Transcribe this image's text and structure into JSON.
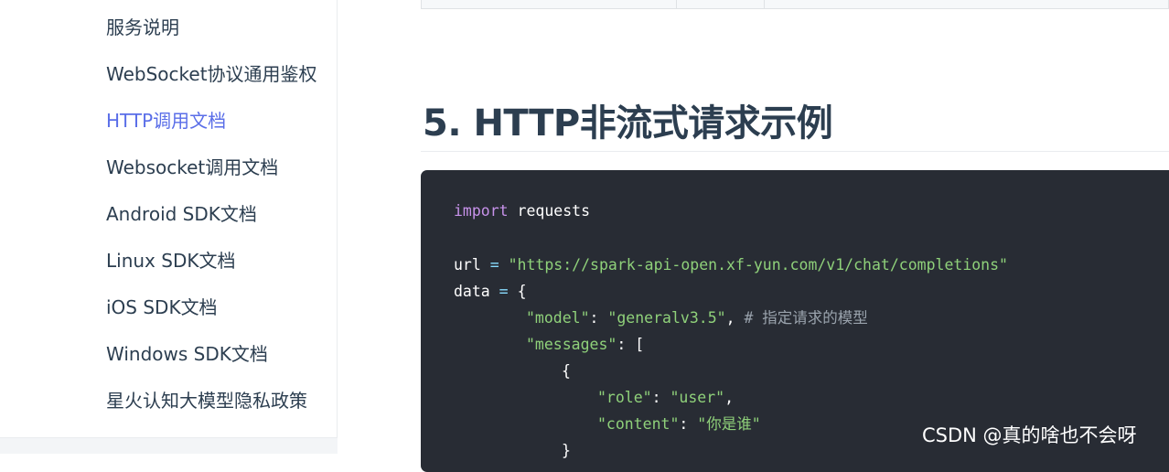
{
  "sidebar": {
    "items": [
      {
        "label": "服务说明"
      },
      {
        "label": "WebSocket协议通用鉴权"
      },
      {
        "label": "HTTP调用文档",
        "active": true
      },
      {
        "label": "Websocket调用文档"
      },
      {
        "label": "Android SDK文档"
      },
      {
        "label": "Linux SDK文档"
      },
      {
        "label": "iOS SDK文档"
      },
      {
        "label": "Windows SDK文档"
      },
      {
        "label": "星火认知大模型隐私政策"
      }
    ]
  },
  "main": {
    "heading": "5. HTTP非流式请求示例",
    "code": {
      "l1_kw": "import",
      "l1_rest": " requests",
      "l3_var": "url",
      "l3_eq": " = ",
      "l3_str": "\"https://spark-api-open.xf-yun.com/v1/chat/completions\"",
      "l4_var": "data",
      "l4_eq": " = ",
      "l4_brace": "{",
      "l5_key": "\"model\"",
      "l5_colon": ": ",
      "l5_val": "\"generalv3.5\"",
      "l5_comma": ", ",
      "l5_comment": "# 指定请求的模型",
      "l6_key": "\"messages\"",
      "l6_colon": ": ",
      "l6_bracket": "[",
      "l7_brace": "{",
      "l8_key": "\"role\"",
      "l8_colon": ": ",
      "l8_val": "\"user\"",
      "l8_comma": ",",
      "l9_key": "\"content\"",
      "l9_colon": ": ",
      "l9_val": "\"你是谁\"",
      "l10_brace": "}"
    }
  },
  "watermark": "CSDN @真的啥也不会呀",
  "colors": {
    "active_link": "#5a6ee8",
    "text": "#2c3e50",
    "code_bg": "#282c34",
    "keyword": "#c792ea",
    "string": "#8fd17a",
    "comment": "#9aa3ad"
  }
}
